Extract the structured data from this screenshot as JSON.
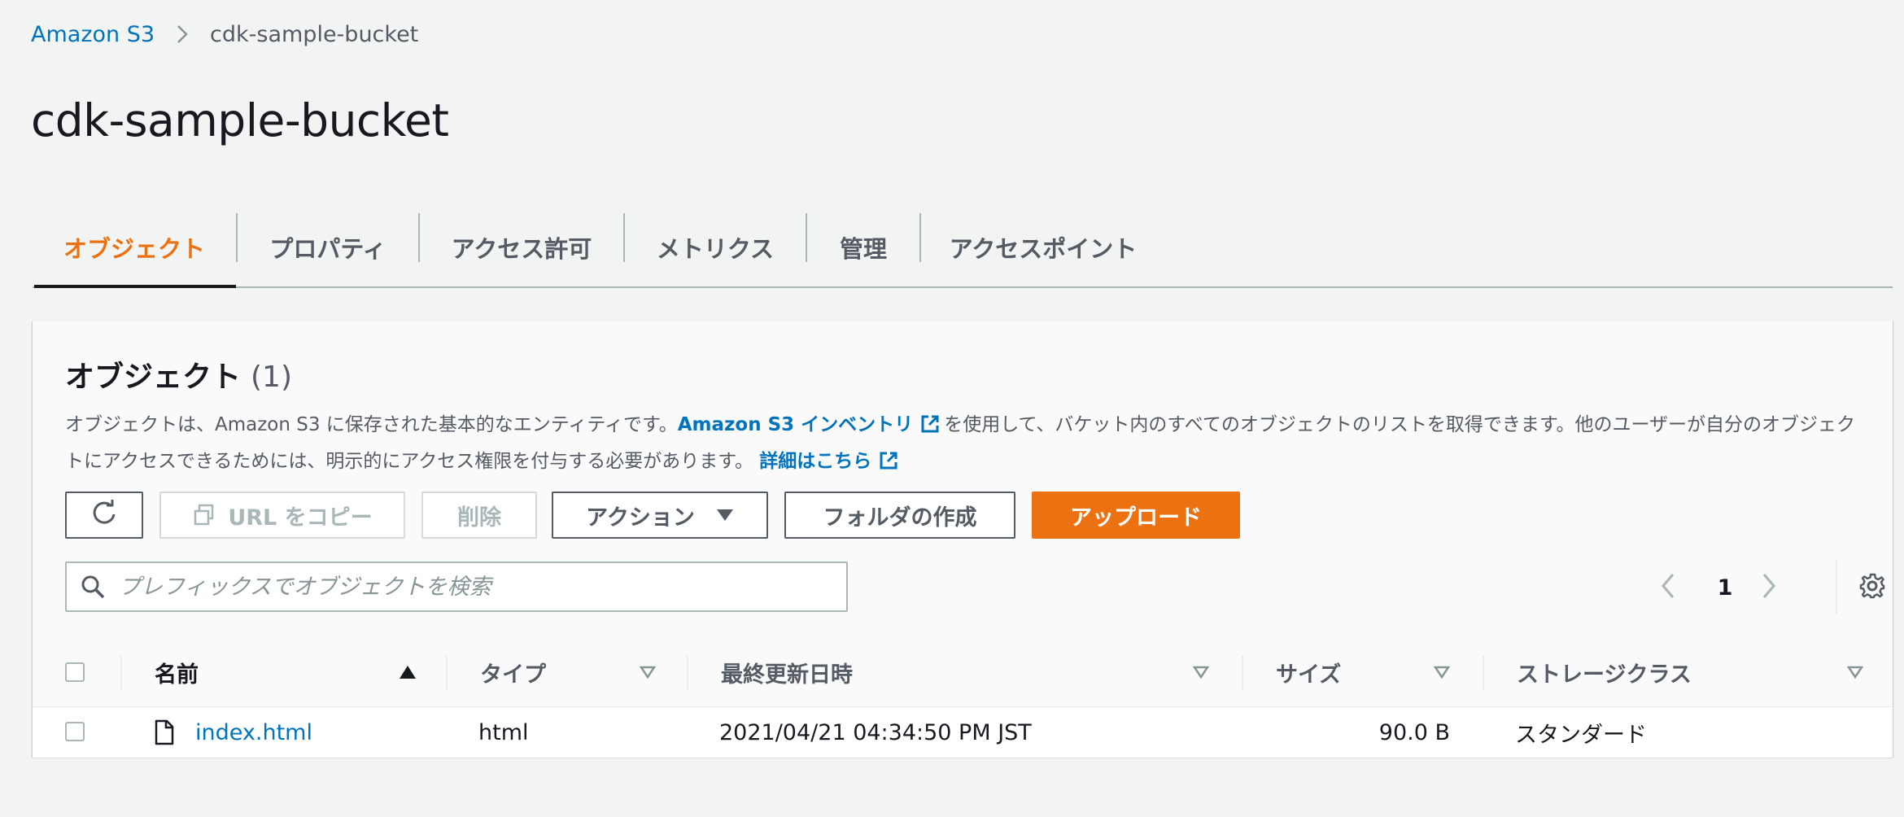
{
  "breadcrumb": {
    "items": [
      {
        "label": "Amazon S3"
      },
      {
        "label": "cdk-sample-bucket"
      }
    ]
  },
  "page": {
    "title": "cdk-sample-bucket"
  },
  "tabs": [
    {
      "label": "オブジェクト",
      "active": true
    },
    {
      "label": "プロパティ"
    },
    {
      "label": "アクセス許可"
    },
    {
      "label": "メトリクス"
    },
    {
      "label": "管理"
    },
    {
      "label": "アクセスポイント"
    }
  ],
  "objects": {
    "title": "オブジェクト",
    "count": "(1)",
    "description": {
      "part1": "オブジェクトは、Amazon S3 に保存された基本的なエンティティです。",
      "link1": "Amazon S3 インベントリ",
      "part2": "を使用して、バケット内のすべてのオブジェクトのリストを取得できます。他のユーザーが自分のオブジェクトにアクセスできるためには、明示的にアクセス権限を付与する必要があります。",
      "link2": "詳細はこちら"
    },
    "toolbar": {
      "copy_url": "URL をコピー",
      "delete": "削除",
      "actions": "アクション",
      "create_folder": "フォルダの作成",
      "upload": "アップロード"
    },
    "search": {
      "placeholder": "プレフィックスでオブジェクトを検索"
    },
    "pagination": {
      "current_page": "1"
    },
    "table": {
      "columns": [
        "名前",
        "タイプ",
        "最終更新日時",
        "サイズ",
        "ストレージクラス"
      ],
      "rows": [
        {
          "name": "index.html",
          "type": "html",
          "last_modified": "2021/04/21 04:34:50 PM JST",
          "size": "90.0 B",
          "storage_class": "スタンダード"
        }
      ]
    }
  },
  "colors": {
    "accent": "#ec7211",
    "link": "#0073bb",
    "text": "#16191f",
    "muted": "#545b64",
    "background": "#f2f3f3"
  },
  "icons": [
    "chevron-right-icon",
    "refresh-icon",
    "copy-icon",
    "caret-down-icon",
    "search-icon",
    "chevron-left-icon",
    "gear-icon",
    "external-link-icon",
    "sort-ascending-icon",
    "sort-icon",
    "file-icon"
  ]
}
